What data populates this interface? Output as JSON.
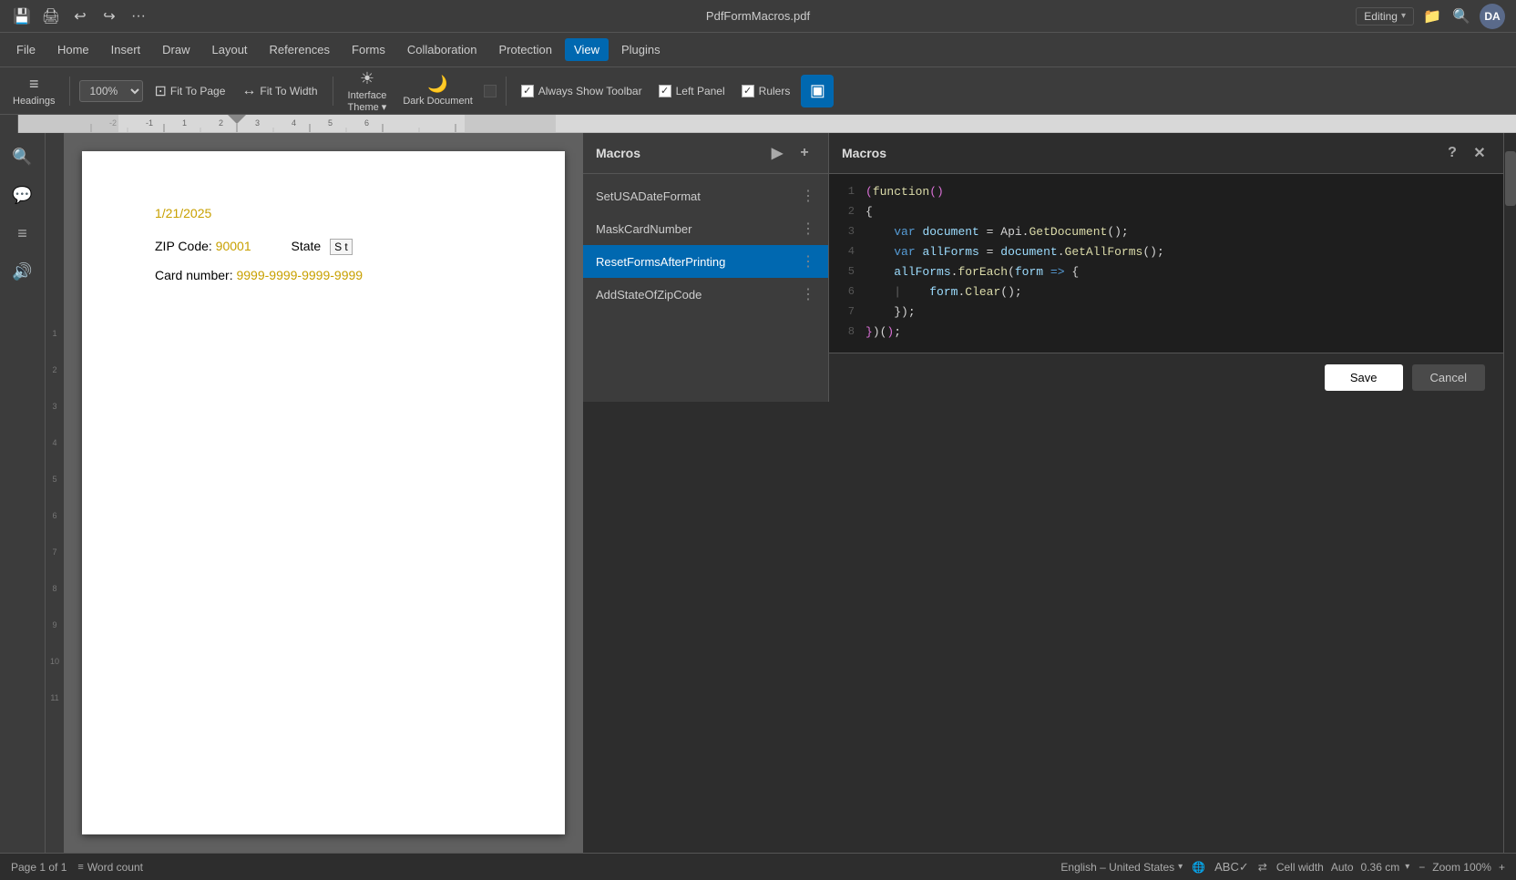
{
  "titleBar": {
    "filename": "PdfFormMacros.pdf",
    "icons": [
      "save",
      "print",
      "undo",
      "redo",
      "more"
    ]
  },
  "menuBar": {
    "items": [
      "File",
      "Home",
      "Insert",
      "Draw",
      "Layout",
      "References",
      "Forms",
      "Collaboration",
      "Protection",
      "View",
      "Plugins"
    ],
    "activeItem": "View"
  },
  "toolbar": {
    "headings": "Headings",
    "zoom": "100%",
    "fitToPage": "Fit To Page",
    "fitToWidth": "Fit To Width",
    "interfaceTheme": "Interface Theme",
    "darkDocument": "Dark Document",
    "alwaysShowToolbar": "Always Show Toolbar",
    "leftPanel": "Left Panel",
    "rulers": "Rulers",
    "checkAlwaysShowToolbar": true,
    "checkLeftPanel": true,
    "checkRulers": true
  },
  "editingBadge": "Editing",
  "document": {
    "date": "1/21/2025",
    "zipLabel": "ZIP Code:",
    "zipValue": "90001",
    "stateLabel": "State",
    "stateValue": "S t",
    "cardLabel": "Card number:",
    "cardValue": "9999-9999-9999-9999"
  },
  "macrosPanel": {
    "title": "Macros",
    "macros": [
      {
        "name": "SetUSADateFormat",
        "selected": false
      },
      {
        "name": "MaskCardNumber",
        "selected": false
      },
      {
        "name": "ResetFormsAfterPrinting",
        "selected": true
      },
      {
        "name": "AddStateOfZipCode",
        "selected": false
      }
    ],
    "runLabel": "▶",
    "addLabel": "+"
  },
  "editorPanel": {
    "title": "Macros",
    "helpLabel": "?",
    "closeLabel": "✕",
    "lines": [
      {
        "num": "1",
        "content": "(function()"
      },
      {
        "num": "2",
        "content": "{"
      },
      {
        "num": "3",
        "content": "    var document = Api.GetDocument();"
      },
      {
        "num": "4",
        "content": "    var allForms = document.GetAllForms();"
      },
      {
        "num": "5",
        "content": "    allForms.forEach(form => {"
      },
      {
        "num": "6",
        "content": "    |    form.Clear();"
      },
      {
        "num": "7",
        "content": "    });"
      },
      {
        "num": "8",
        "content": "})();"
      }
    ]
  },
  "dialog": {
    "saveLabel": "Save",
    "cancelLabel": "Cancel"
  },
  "statusBar": {
    "page": "Page 1 of 1",
    "wordCount": "Word count",
    "language": "English – United States",
    "zoom": "Zoom 100%",
    "cellWidth": "Cell width",
    "cellWidthValue": "Auto",
    "cellWidthUnit": "0.36 cm"
  },
  "codeColors": {
    "keyword": "#569cd6",
    "function": "#dcdcaa",
    "variable": "#9cdcfe",
    "string": "#ce9178",
    "bracket": "#da70d6",
    "normal": "#d4d4d4"
  },
  "rulerMarkers": [
    "-2",
    "-1",
    "1",
    "2",
    "3",
    "4",
    "5",
    "6"
  ],
  "vRulerMarkers": [
    "1",
    "2",
    "3",
    "4",
    "5",
    "6",
    "7",
    "8",
    "9",
    "10",
    "11"
  ]
}
